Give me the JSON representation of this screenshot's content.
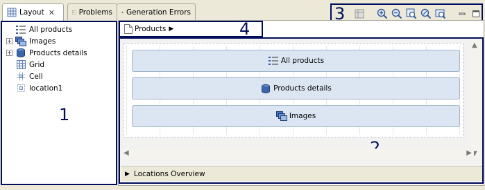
{
  "tabs": [
    {
      "label": "Layout",
      "icon": "grid-icon",
      "active": true,
      "closable": true
    },
    {
      "label": "Problems",
      "icon": "problems-icon",
      "active": false
    },
    {
      "label": "Generation Errors",
      "icon": "generation-errors-icon",
      "active": false
    }
  ],
  "tree": [
    {
      "label": "All products",
      "icon": "list-icon",
      "expandable": false
    },
    {
      "label": "Images",
      "icon": "images-stack-icon",
      "expandable": true
    },
    {
      "label": "Products details",
      "icon": "database-icon",
      "expandable": true
    },
    {
      "label": "Grid",
      "icon": "grid-icon",
      "expandable": false
    },
    {
      "label": "Cell",
      "icon": "cell-icon",
      "expandable": false
    },
    {
      "label": "location1",
      "icon": "location-icon",
      "expandable": false
    }
  ],
  "breadcrumb": {
    "label": "Products"
  },
  "blocks": [
    {
      "label": "All products",
      "icon": "list-icon"
    },
    {
      "label": "Products details",
      "icon": "database-icon"
    },
    {
      "label": "Images",
      "icon": "images-stack-icon"
    }
  ],
  "overview": {
    "label": "Locations Overview"
  },
  "toolbar": {
    "buttons": [
      "layout-icon",
      "zoom-in-icon",
      "zoom-out-icon",
      "zoom-fit-icon",
      "zoom-custom-icon",
      "zoom-page-icon",
      "minimize-icon",
      "maximize-icon"
    ]
  },
  "annotations": {
    "n1": "1",
    "n2": "2",
    "n3": "3",
    "n4": "4"
  },
  "colors": {
    "annotation": "#000d5c",
    "block_fill": "#dce6f2"
  }
}
